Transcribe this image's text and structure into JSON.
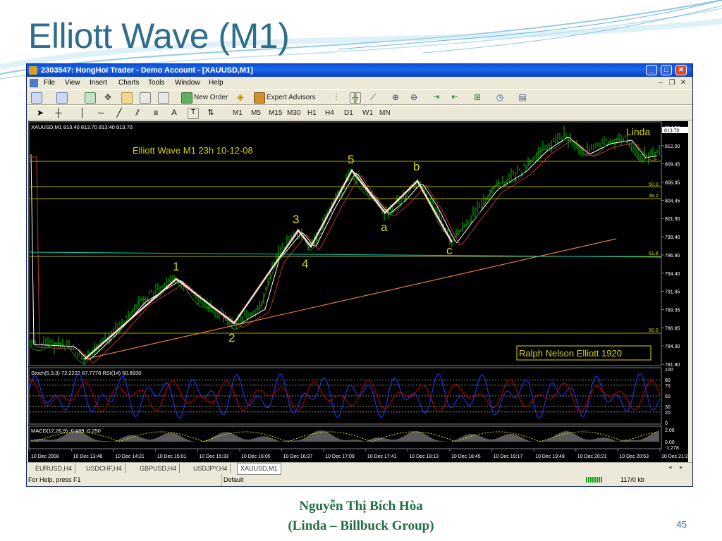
{
  "slide": {
    "title": "Elliott Wave (M1)",
    "author_line1": "Nguyễn Thị Bích Hòa",
    "author_line2": "(Linda – Billbuck Group)",
    "page_number": "45",
    "colors": {
      "title": "#2e6e8c",
      "author": "#1f6e44",
      "swoosh": "#6ab6d8"
    }
  },
  "window": {
    "title": "2303547: HongHoi Trader - Demo Account - [XAUUSD,M1]",
    "menu": [
      "File",
      "View",
      "Insert",
      "Charts",
      "Tools",
      "Window",
      "Help"
    ],
    "toolbar1": {
      "new_order": "New Order",
      "expert_advisors": "Expert Advisors"
    },
    "timeframes": [
      "M1",
      "M5",
      "M15",
      "M30",
      "H1",
      "H4",
      "D1",
      "W1",
      "MN"
    ],
    "tabs": [
      "EURUSD,H4",
      "USDCHF,H4",
      "GBPUSD,H4",
      "USDJPY,H4",
      "XAUUSD,M1"
    ],
    "active_tab": "XAUUSD,M1",
    "status": {
      "help": "For Help, press F1",
      "profile": "Default",
      "traffic": "117/0 kb"
    }
  },
  "chart": {
    "symbol_info": "XAUUSD,M1  813.40 813.70 813.40 813.70",
    "heading": "Elliott Wave M1 23h 10-12-08",
    "watermark": "Linda",
    "credit": "Ralph Nelson Elliott 1920",
    "current_price": "813.70",
    "wave_labels": [
      "1",
      "2",
      "3",
      "4",
      "5",
      "a",
      "b",
      "c"
    ],
    "fib_labels": [
      "50.0",
      "38.2",
      "61.8",
      "50.0"
    ],
    "price_ticks": [
      "814.50",
      "812.00",
      "809.45",
      "806.95",
      "804.45",
      "801.90",
      "799.40",
      "796.90",
      "794.40",
      "791.85",
      "789.35",
      "786.85",
      "784.30",
      "781.80"
    ],
    "stoch_label": "Stoch(5,3,3) 72.2222 67.7778  RSI(14) 50.8930",
    "stoch_ticks": [
      "100",
      "80",
      "70",
      "50",
      "30",
      "20",
      "0"
    ],
    "macd_label": "MACD(12,26,9) -0.189 -0.250",
    "macd_ticks": [
      "2.06",
      "0.00",
      "-1.278"
    ],
    "time_labels": [
      "10 Dec 2008",
      "10 Dec 13:46",
      "10 Dec 14:21",
      "10 Dec 15:01",
      "10 Dec 15:33",
      "10 Dec 16:05",
      "10 Dec 16:37",
      "10 Dec 17:09",
      "10 Dec 17:41",
      "10 Dec 18:13",
      "10 Dec 18:45",
      "10 Dec 19:17",
      "10 Dec 19:49",
      "10 Dec 20:21",
      "10 Dec 20:53",
      "10 Dec 21:2"
    ],
    "colors": {
      "bg": "#000000",
      "candles": "#00c800",
      "wave": "#ffc8c8",
      "trendline": "#e07a3a",
      "fib": "#a8a800",
      "text": "#d8d800",
      "stoch": "#1e3cff",
      "rsi": "#c80000",
      "macd": "#b4b4b4"
    }
  }
}
